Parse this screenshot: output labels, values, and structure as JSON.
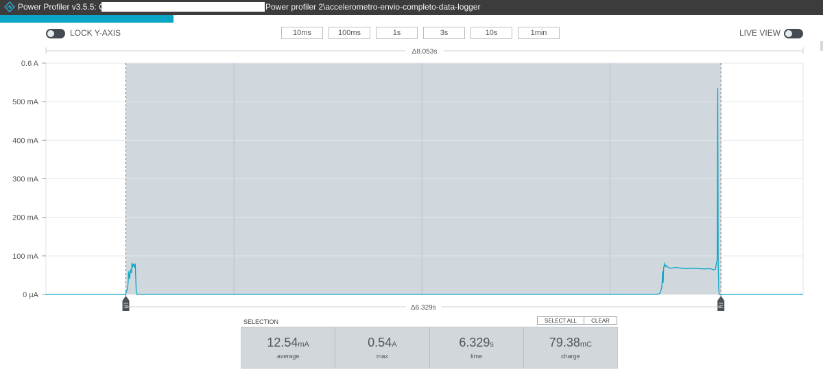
{
  "window": {
    "title_prefix": "Power Profiler v3.5.5: C:\\",
    "title_suffix": "Power profiler 2\\accelerometro-envio-completo-data-logger"
  },
  "toolbar": {
    "lock_y_axis_label": "LOCK Y-AXIS",
    "lock_y_axis_on": false,
    "live_view_label": "LIVE VIEW",
    "live_view_on": false,
    "time_windows": [
      "10ms",
      "100ms",
      "1s",
      "3s",
      "10s",
      "1min"
    ]
  },
  "chart_data": {
    "type": "line",
    "y_unit": "A",
    "ylim": [
      0,
      0.6
    ],
    "y_ticks": [
      {
        "value": 0.6,
        "label": "0.6 A"
      },
      {
        "value": 0.5,
        "label": "500 mA"
      },
      {
        "value": 0.4,
        "label": "400 mA"
      },
      {
        "value": 0.3,
        "label": "300 mA"
      },
      {
        "value": 0.2,
        "label": "200 mA"
      },
      {
        "value": 0.1,
        "label": "100 mA"
      },
      {
        "value": 0.0,
        "label": "0 µA"
      }
    ],
    "window_delta_label": "Δ8.053s",
    "selection_delta_label": "Δ6.329s",
    "window_duration_s": 8.053,
    "selection_start_s": 0.85,
    "selection_end_s": 7.179,
    "grid": true,
    "series": [
      {
        "color": "#0aa6c6",
        "x": [
          0.0,
          0.84,
          0.85,
          0.86,
          0.87,
          0.875,
          0.88,
          0.89,
          0.9,
          0.91,
          0.915,
          0.92,
          0.93,
          0.94,
          0.95,
          0.96,
          0.97,
          0.98,
          1.0,
          1.5,
          3.0,
          5.0,
          6.0,
          6.5,
          6.53,
          6.54,
          6.55,
          6.56,
          6.565,
          6.57,
          6.58,
          6.59,
          6.6,
          6.62,
          6.65,
          6.7,
          6.8,
          6.9,
          7.0,
          7.05,
          7.08,
          7.1,
          7.12,
          7.13,
          7.14,
          7.145,
          7.15,
          7.155,
          7.16,
          7.17,
          7.18,
          7.19,
          7.3,
          8.053
        ],
        "y": [
          0.0,
          0.0,
          0.003,
          0.01,
          0.02,
          0.035,
          0.06,
          0.04,
          0.065,
          0.055,
          0.082,
          0.07,
          0.08,
          0.07,
          0.08,
          0.01,
          0.0,
          0.0,
          0.0,
          0.0,
          0.0,
          0.0,
          0.0,
          0.0,
          0.003,
          0.01,
          0.02,
          0.06,
          0.03,
          0.07,
          0.08,
          0.072,
          0.075,
          0.069,
          0.068,
          0.07,
          0.067,
          0.068,
          0.066,
          0.067,
          0.066,
          0.064,
          0.065,
          0.08,
          0.09,
          0.535,
          0.08,
          0.02,
          0.0,
          0.0,
          0.0,
          0.0,
          0.0,
          0.0
        ]
      }
    ]
  },
  "selection": {
    "label": "SELECTION",
    "select_all_label": "SELECT ALL",
    "clear_label": "CLEAR",
    "stats": [
      {
        "value": "12.54",
        "unit": "mA",
        "caption": "average"
      },
      {
        "value": "0.54",
        "unit": "A",
        "caption": "max"
      },
      {
        "value": "6.329",
        "unit": "s",
        "caption": "time"
      },
      {
        "value": "79.38",
        "unit": "mC",
        "caption": "charge"
      }
    ]
  },
  "colors": {
    "accent": "#0aa6c6",
    "selection_fill": "#d0d8de",
    "titlebar": "#3c3c3c"
  }
}
